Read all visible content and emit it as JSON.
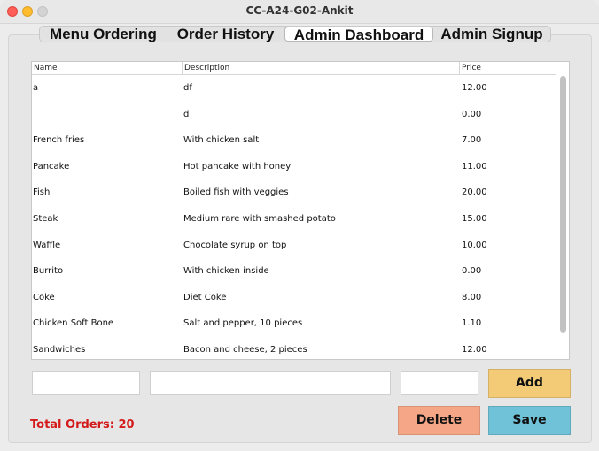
{
  "window": {
    "title": "CC-A24-G02-Ankit"
  },
  "tabs": [
    {
      "label": "Menu Ordering"
    },
    {
      "label": "Order History"
    },
    {
      "label": "Admin Dashboard"
    },
    {
      "label": "Admin Signup"
    }
  ],
  "table": {
    "columns": [
      "Name",
      "Description",
      "Price"
    ],
    "rows": [
      {
        "name": "a",
        "description": "df",
        "price": "12.00"
      },
      {
        "name": "",
        "description": "d",
        "price": "0.00"
      },
      {
        "name": "French fries",
        "description": "With chicken salt",
        "price": "7.00"
      },
      {
        "name": "Pancake",
        "description": "Hot pancake with honey",
        "price": "11.00"
      },
      {
        "name": "Fish",
        "description": "Boiled fish with veggies",
        "price": "20.00"
      },
      {
        "name": "Steak",
        "description": "Medium rare with smashed potato",
        "price": "15.00"
      },
      {
        "name": "Waffle",
        "description": "Chocolate syrup on top",
        "price": "10.00"
      },
      {
        "name": "Burrito",
        "description": "With chicken inside",
        "price": "0.00"
      },
      {
        "name": "Coke",
        "description": "Diet Coke",
        "price": "8.00"
      },
      {
        "name": "Chicken Soft Bone",
        "description": "Salt and pepper, 10 pieces",
        "price": "1.10"
      },
      {
        "name": "Sandwiches",
        "description": "Bacon and cheese, 2 pieces",
        "price": "12.00"
      }
    ]
  },
  "form": {
    "name_value": "",
    "description_value": "",
    "price_value": ""
  },
  "buttons": {
    "add_label": "Add",
    "delete_label": "Delete",
    "save_label": "Save"
  },
  "status": {
    "total_orders": "Total Orders: 20"
  },
  "colors": {
    "add": "#f3ca76",
    "delete": "#f5a686",
    "save": "#6fc2d8",
    "total_text": "#d41b1b"
  }
}
